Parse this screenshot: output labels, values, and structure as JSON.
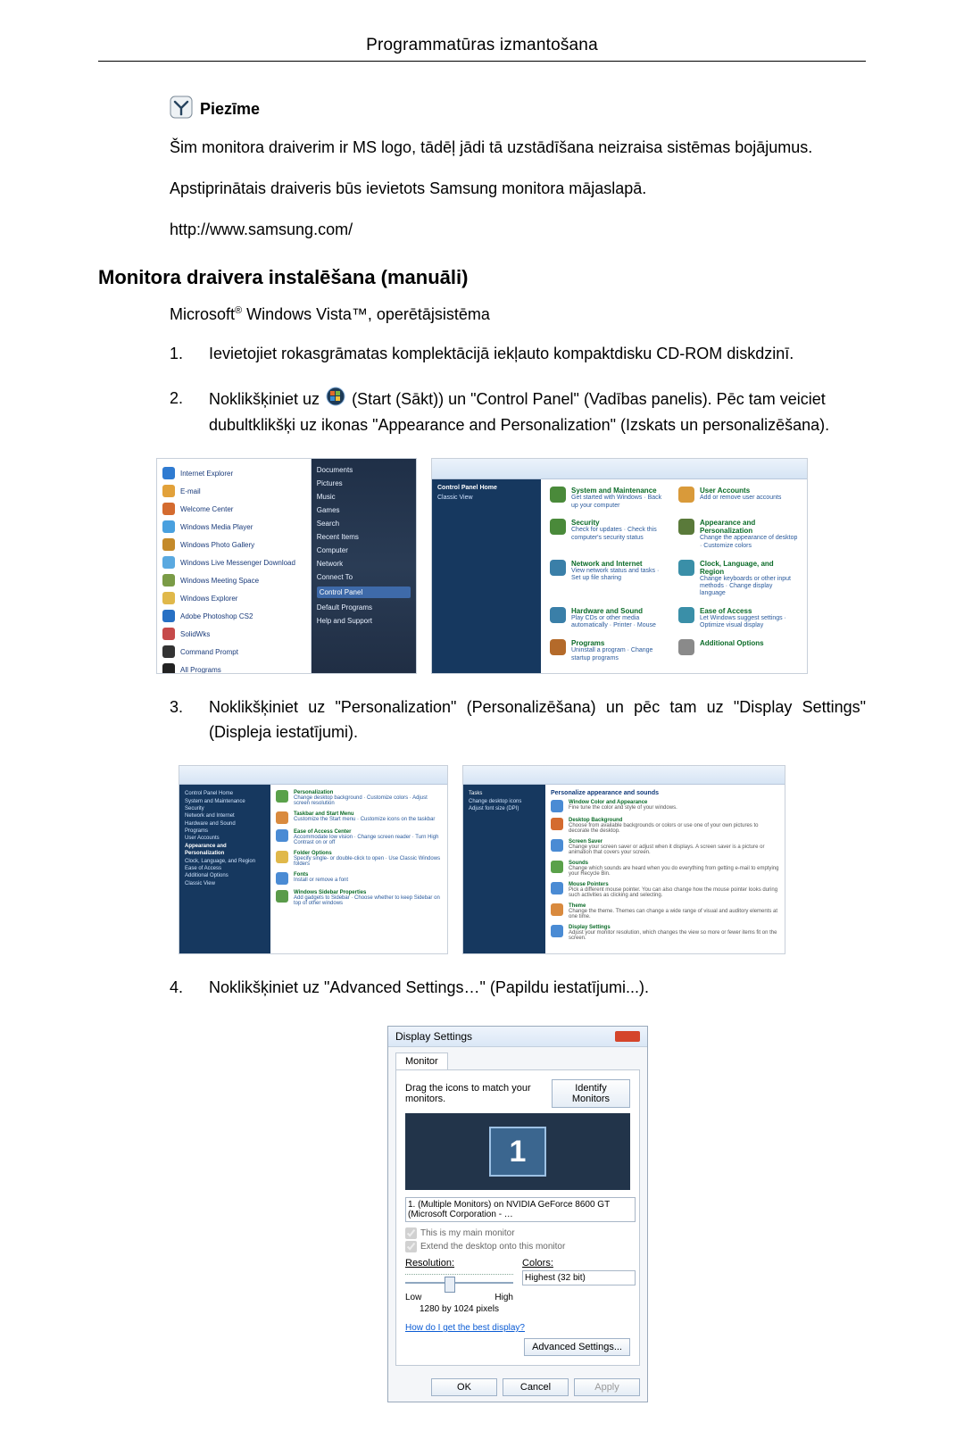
{
  "header": {
    "title": "Programmatūras izmantošana"
  },
  "note": {
    "label": "Piezīme",
    "para1": "Šim monitora draiverim ir MS logo, tādēļ jādi tā uzstādīšana neizraisa sistēmas bojājumus.",
    "para2": "Apstiprinātais draiveris būs ievietots Samsung monitora mājaslapā.",
    "url": "http://www.samsung.com/"
  },
  "section": {
    "heading": "Monitora draivera instalēšana (manuāli)",
    "subsystem_prefix": "Microsoft",
    "subsystem_mid": " Windows Vista™, operētājsistēma"
  },
  "steps": {
    "s1": {
      "num": "1.",
      "text": "Ievietojiet rokasgrāmatas komplektācijā iekļauto kompaktdisku CD-ROM diskdzinī."
    },
    "s2": {
      "num": "2.",
      "text_a": "Noklikšķiniet uz ",
      "text_b": "(Start (Sākt)) un \"Control Panel\" (Vadības panelis). Pēc tam veiciet dubultklikšķi uz ikonas \"Appearance and Personalization\" (Izskats un personalizēšana)."
    },
    "s3": {
      "num": "3.",
      "text": "Noklikšķiniet uz \"Personalization\" (Personalizēšana) un pēc tam uz \"Display Settings\" (Displeja iestatījumi)."
    },
    "s4": {
      "num": "4.",
      "text": "Noklikšķiniet uz \"Advanced Settings…\" (Papildu iestatījumi...)."
    }
  },
  "start_menu": {
    "items": [
      "Internet Explorer",
      "E-mail",
      "Welcome Center",
      "Windows Media Player",
      "Windows Photo Gallery",
      "Windows Live Messenger Download",
      "Windows Meeting Space",
      "Windows Explorer",
      "Adobe Photoshop CS2",
      "SolidWks",
      "Command Prompt",
      "All Programs"
    ],
    "right": [
      "Documents",
      "Pictures",
      "Music",
      "Games",
      "Search",
      "Recent Items",
      "Computer",
      "Network",
      "Connect To",
      "Control Panel",
      "Default Programs",
      "Help and Support"
    ]
  },
  "control_panel": {
    "nav_title": "Control Panel Home",
    "nav_item": "Classic View",
    "categories": [
      {
        "title": "System and Maintenance",
        "sub": "Get started with Windows · Back up your computer"
      },
      {
        "title": "User Accounts",
        "sub": "Add or remove user accounts"
      },
      {
        "title": "Security",
        "sub": "Check for updates · Check this computer's security status"
      },
      {
        "title": "Appearance and Personalization",
        "sub": "Change the appearance of desktop · Customize colors"
      },
      {
        "title": "Network and Internet",
        "sub": "View network status and tasks · Set up file sharing"
      },
      {
        "title": "Clock, Language, and Region",
        "sub": "Change keyboards or other input methods · Change display language"
      },
      {
        "title": "Hardware and Sound",
        "sub": "Play CDs or other media automatically · Printer · Mouse"
      },
      {
        "title": "Ease of Access",
        "sub": "Let Windows suggest settings · Optimize visual display"
      },
      {
        "title": "Programs",
        "sub": "Uninstall a program · Change startup programs"
      },
      {
        "title": "Additional Options",
        "sub": ""
      }
    ]
  },
  "personalization": {
    "left_items": [
      "Control Panel Home",
      "System and Maintenance",
      "Security",
      "Network and Internet",
      "Hardware and Sound",
      "Programs",
      "User Accounts",
      "Appearance and Personalization",
      "Clock, Language, and Region",
      "Ease of Access",
      "Additional Options",
      "Classic View"
    ],
    "right_heading": "Personalize appearance and sounds",
    "right_items": [
      {
        "t": "Window Color and Appearance",
        "d": "Fine tune the color and style of your windows."
      },
      {
        "t": "Desktop Background",
        "d": "Choose from available backgrounds or colors or use one of your own pictures to decorate the desktop."
      },
      {
        "t": "Screen Saver",
        "d": "Change your screen saver or adjust when it displays. A screen saver is a picture or animation that covers your screen."
      },
      {
        "t": "Sounds",
        "d": "Change which sounds are heard when you do everything from getting e-mail to emptying your Recycle Bin."
      },
      {
        "t": "Mouse Pointers",
        "d": "Pick a different mouse pointer. You can also change how the mouse pointer looks during such activities as clicking and selecting."
      },
      {
        "t": "Theme",
        "d": "Change the theme. Themes can change a wide range of visual and auditory elements at one time."
      },
      {
        "t": "Display Settings",
        "d": "Adjust your monitor resolution, which changes the view so more or fewer items fit on the screen."
      }
    ]
  },
  "appearance_panel": {
    "items": [
      {
        "t": "Personalization",
        "d": "Change desktop background · Customize colors · Adjust screen resolution"
      },
      {
        "t": "Taskbar and Start Menu",
        "d": "Customize the Start menu · Customize icons on the taskbar"
      },
      {
        "t": "Ease of Access Center",
        "d": "Accommodate low vision · Change screen reader · Turn High Contrast on or off"
      },
      {
        "t": "Folder Options",
        "d": "Specify single- or double-click to open · Use Classic Windows folders"
      },
      {
        "t": "Fonts",
        "d": "Install or remove a font"
      },
      {
        "t": "Windows Sidebar Properties",
        "d": "Add gadgets to Sidebar · Choose whether to keep Sidebar on top of other windows"
      }
    ]
  },
  "display_settings": {
    "title": "Display Settings",
    "tab": "Monitor",
    "drag_text": "Drag the icons to match your monitors.",
    "identify": "Identify Monitors",
    "mon_number": "1",
    "dropdown": "1. (Multiple Monitors) on NVIDIA GeForce 8600 GT (Microsoft Corporation - …",
    "chk1": "This is my main monitor",
    "chk2": "Extend the desktop onto this monitor",
    "res_label": "Resolution:",
    "low": "Low",
    "high": "High",
    "res_value": "1280 by 1024 pixels",
    "colors_label": "Colors:",
    "colors_value": "Highest (32 bit)",
    "help_link": "How do I get the best display?",
    "advanced": "Advanced Settings...",
    "ok": "OK",
    "cancel": "Cancel",
    "apply": "Apply"
  }
}
